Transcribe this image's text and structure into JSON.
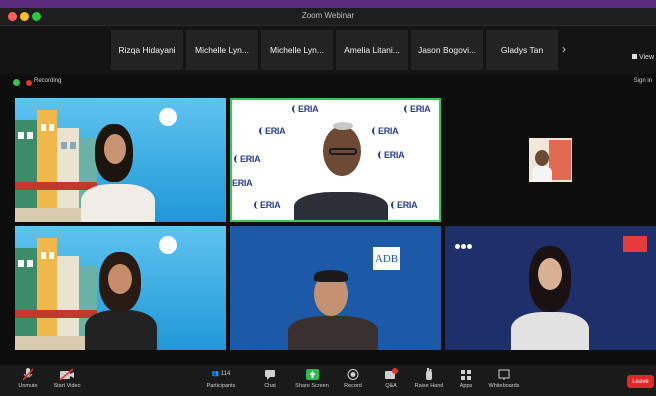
{
  "window": {
    "title": "Zoom Webinar",
    "traffic_lights": [
      "#ff5f57",
      "#febc2e",
      "#28c840"
    ]
  },
  "participant_strip": {
    "names": [
      "Rizqa Hidayani",
      "Michelle Lyn...",
      "Michelle Lyn...",
      "Amelia Litani...",
      "Jason Bogovi...",
      "Gladys Tan"
    ],
    "next_icon": "chevron-right-icon"
  },
  "view_button": {
    "label": "View"
  },
  "status": {
    "recording_label": "Recording",
    "sign_label": "Sign in"
  },
  "video_tiles": [
    {
      "kind": "speaker-building-background",
      "active_speaker": false
    },
    {
      "kind": "eria-backdrop-speaker",
      "active_speaker": true
    },
    {
      "kind": "small-thumbnail",
      "active_speaker": false
    },
    {
      "kind": "speaker-building-background",
      "active_speaker": false
    },
    {
      "kind": "adb-speaker",
      "adb_logo": "ADB",
      "active_speaker": false
    },
    {
      "kind": "speaker-blue-backdrop",
      "active_speaker": false
    }
  ],
  "eria_label": "ERIA",
  "toolbar": {
    "buttons": [
      {
        "label": "Unmute",
        "icon": "microphone-icon"
      },
      {
        "label": "Start Video",
        "icon": "video-camera-icon"
      },
      {
        "label": "Participants",
        "icon": "participants-icon",
        "count": "114"
      },
      {
        "label": "Chat",
        "icon": "chat-icon"
      },
      {
        "label": "Share Screen",
        "icon": "share-screen-icon"
      },
      {
        "label": "Record",
        "icon": "record-icon"
      },
      {
        "label": "Q&A",
        "icon": "qa-icon"
      },
      {
        "label": "Raise Hand",
        "icon": "raise-hand-icon"
      },
      {
        "label": "Apps",
        "icon": "apps-icon"
      },
      {
        "label": "Whiteboards",
        "icon": "whiteboard-icon"
      }
    ],
    "leave_label": "Leave",
    "colors": {
      "share_green": "#2dba4e",
      "leave_red": "#e02828",
      "qa_badge": "#e3342f"
    }
  }
}
